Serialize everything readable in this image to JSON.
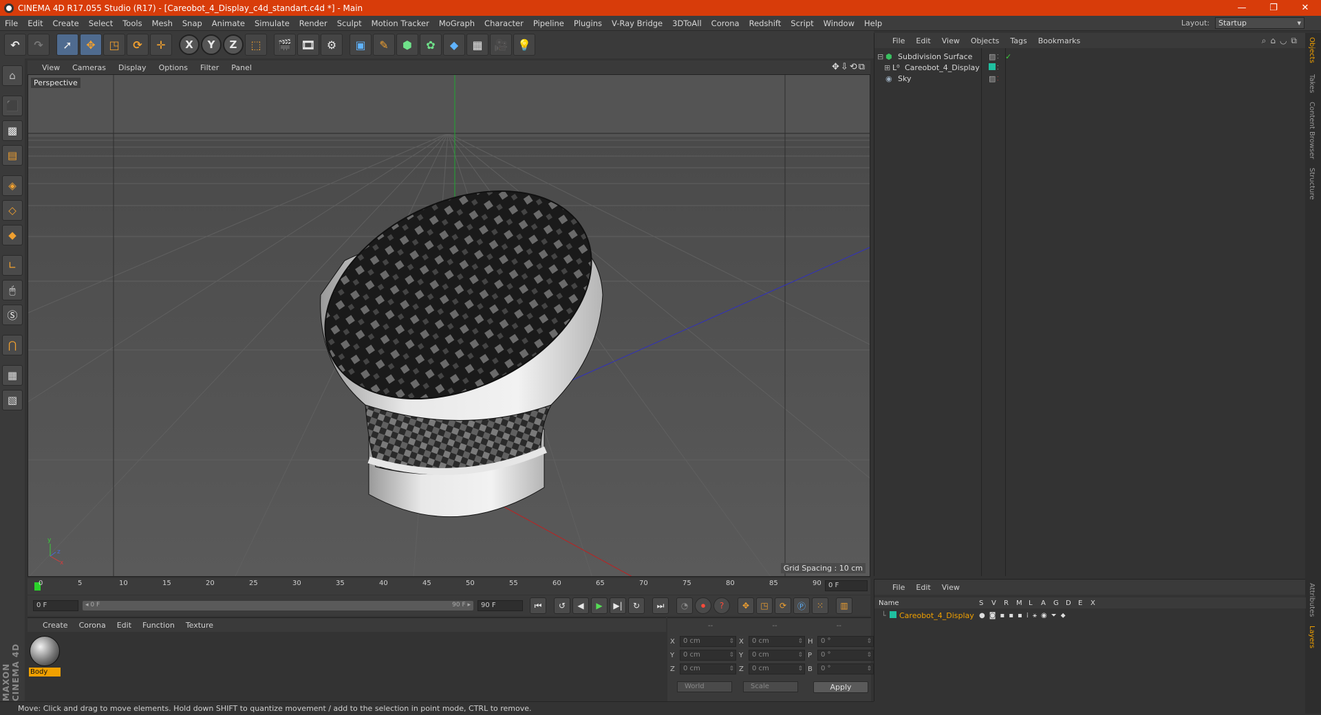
{
  "window": {
    "title": "CINEMA 4D R17.055 Studio (R17) - [Careobot_4_Display_c4d_standart.c4d *] - Main",
    "minimize": "—",
    "restore": "❐",
    "close": "✕"
  },
  "menu": [
    "File",
    "Edit",
    "Create",
    "Select",
    "Tools",
    "Mesh",
    "Snap",
    "Animate",
    "Simulate",
    "Render",
    "Sculpt",
    "Motion Tracker",
    "MoGraph",
    "Character",
    "Pipeline",
    "Plugins",
    "V-Ray Bridge",
    "3DToAll",
    "Corona",
    "Redshift",
    "Script",
    "Window",
    "Help"
  ],
  "layout": {
    "label": "Layout:",
    "value": "Startup"
  },
  "viewport": {
    "menu": [
      "View",
      "Cameras",
      "Display",
      "Options",
      "Filter",
      "Panel"
    ],
    "label": "Perspective",
    "grid_spacing": "Grid Spacing : 10 cm",
    "nav_icons": "✥⇩⟲⧉"
  },
  "timeline": {
    "ticks": [
      "0",
      "5",
      "10",
      "15",
      "20",
      "25",
      "30",
      "35",
      "40",
      "45",
      "50",
      "55",
      "60",
      "65",
      "70",
      "75",
      "80",
      "85",
      "90"
    ],
    "current_frame": "0 F",
    "start_field": "0 F",
    "slider_start": "◂ 0 F",
    "slider_end": "90 F ▸",
    "end_field": "90 F"
  },
  "material_panel": {
    "menu": [
      "Create",
      "Corona",
      "Edit",
      "Function",
      "Texture"
    ],
    "material_name": "Body"
  },
  "coordinates": {
    "headers": [
      "--",
      "--",
      "--"
    ],
    "rows": [
      {
        "l1": "X",
        "v1": "0 cm",
        "l2": "X",
        "v2": "0 cm",
        "l3": "H",
        "v3": "0 °"
      },
      {
        "l1": "Y",
        "v1": "0 cm",
        "l2": "Y",
        "v2": "0 cm",
        "l3": "P",
        "v3": "0 °"
      },
      {
        "l1": "Z",
        "v1": "0 cm",
        "l2": "Z",
        "v2": "0 cm",
        "l3": "B",
        "v3": "0 °"
      }
    ],
    "world": "World",
    "scale": "Scale",
    "apply": "Apply"
  },
  "status": "Move: Click and drag to move elements. Hold down SHIFT to quantize movement / add to the selection in point mode, CTRL to remove.",
  "object_manager": {
    "menu": [
      "File",
      "Edit",
      "View",
      "Objects",
      "Tags",
      "Bookmarks"
    ],
    "objects": [
      {
        "name": "Subdivision Surface",
        "icon": "subdivision-icon"
      },
      {
        "name": "Careobot_4_Display",
        "icon": "null-object-icon"
      },
      {
        "name": "Sky",
        "icon": "sky-icon"
      }
    ]
  },
  "side_tabs": [
    "Objects",
    "Takes",
    "Content Browser",
    "Structure"
  ],
  "side_tabs_bottom": [
    "Attributes",
    "Layers"
  ],
  "layer_manager": {
    "menu": [
      "File",
      "Edit",
      "View"
    ],
    "columns": [
      "Name",
      "S",
      "V",
      "R",
      "M",
      "L",
      "A",
      "G",
      "D",
      "E",
      "X"
    ],
    "layer_name": "Careobot_4_Display"
  },
  "maxon_logo": "MAXON CINEMA 4D",
  "colors": {
    "title_bar": "#d83c0a",
    "accent": "#f0a000",
    "layer_color": "#20c0a0"
  }
}
